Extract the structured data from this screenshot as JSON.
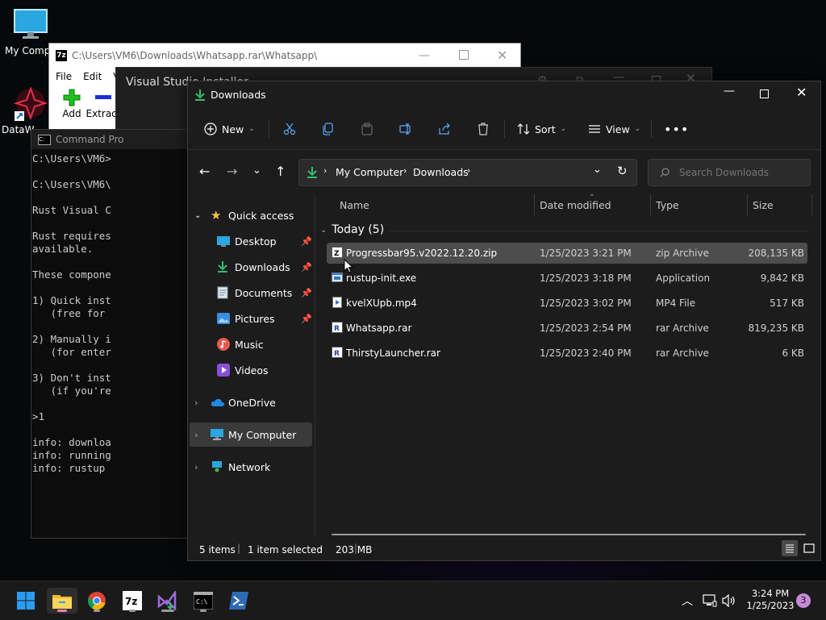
{
  "desktop": {
    "icons": [
      {
        "label": "My Compu"
      },
      {
        "label": "DataW"
      }
    ]
  },
  "zip_window": {
    "title": "C:\\Users\\VM6\\Downloads\\Whatsapp.rar\\Whatsapp\\",
    "menu": [
      "File",
      "Edit",
      "Vi"
    ],
    "tools": [
      "Add",
      "Extract"
    ]
  },
  "vs_installer": {
    "title": "Visual Studio Installer"
  },
  "cmd_window": {
    "title": "Command Pro",
    "lines": [
      "C:\\Users\\VM6>",
      "",
      "C:\\Users\\VM6\\",
      "",
      "Rust Visual C",
      "",
      "Rust requires",
      "available.",
      "",
      "These compone",
      "",
      "1) Quick inst",
      "   (free for",
      "",
      "2) Manually i",
      "   (for enter",
      "",
      "3) Don't inst",
      "   (if you're",
      "",
      ">1",
      "",
      "info: downloa",
      "info: running",
      "info: rustup "
    ]
  },
  "explorer": {
    "title": "Downloads",
    "toolbar": {
      "new_label": "New",
      "sort_label": "Sort",
      "view_label": "View"
    },
    "address": {
      "crumbs": [
        "My Computer",
        "Downloads"
      ]
    },
    "search": {
      "placeholder": "Search Downloads"
    },
    "nav": {
      "quick_access": "Quick access",
      "pinned": [
        "Desktop",
        "Downloads",
        "Documents",
        "Pictures"
      ],
      "others": [
        "Music",
        "Videos"
      ],
      "onedrive": "OneDrive",
      "my_computer": "My Computer",
      "network": "Network"
    },
    "columns": {
      "name": "Name",
      "date": "Date modified",
      "type": "Type",
      "size": "Size"
    },
    "group_label": "Today (5)",
    "files": [
      {
        "name": "Progressbar95.v2022.12.20.zip",
        "date": "1/25/2023 3:21 PM",
        "type": "zip Archive",
        "size": "208,135 KB",
        "icon": "zip-archive-icon"
      },
      {
        "name": "rustup-init.exe",
        "date": "1/25/2023 3:18 PM",
        "type": "Application",
        "size": "9,842 KB",
        "icon": "application-icon"
      },
      {
        "name": "kvelXUpb.mp4",
        "date": "1/25/2023 3:02 PM",
        "type": "MP4 File",
        "size": "517 KB",
        "icon": "video-file-icon"
      },
      {
        "name": "Whatsapp.rar",
        "date": "1/25/2023 2:54 PM",
        "type": "rar Archive",
        "size": "819,235 KB",
        "icon": "rar-archive-icon"
      },
      {
        "name": "ThirstyLauncher.rar",
        "date": "1/25/2023 2:40 PM",
        "type": "rar Archive",
        "size": "6 KB",
        "icon": "rar-archive-icon"
      }
    ],
    "status": {
      "items": "5 items",
      "selected": "1 item selected",
      "size": "203 MB"
    }
  },
  "taskbar": {
    "time": "3:24 PM",
    "date": "1/25/2023",
    "notifications": "3"
  },
  "colors": {
    "accent": "#0078d4",
    "download_green": "#2fbf71",
    "selection": "#4d4d4d"
  }
}
